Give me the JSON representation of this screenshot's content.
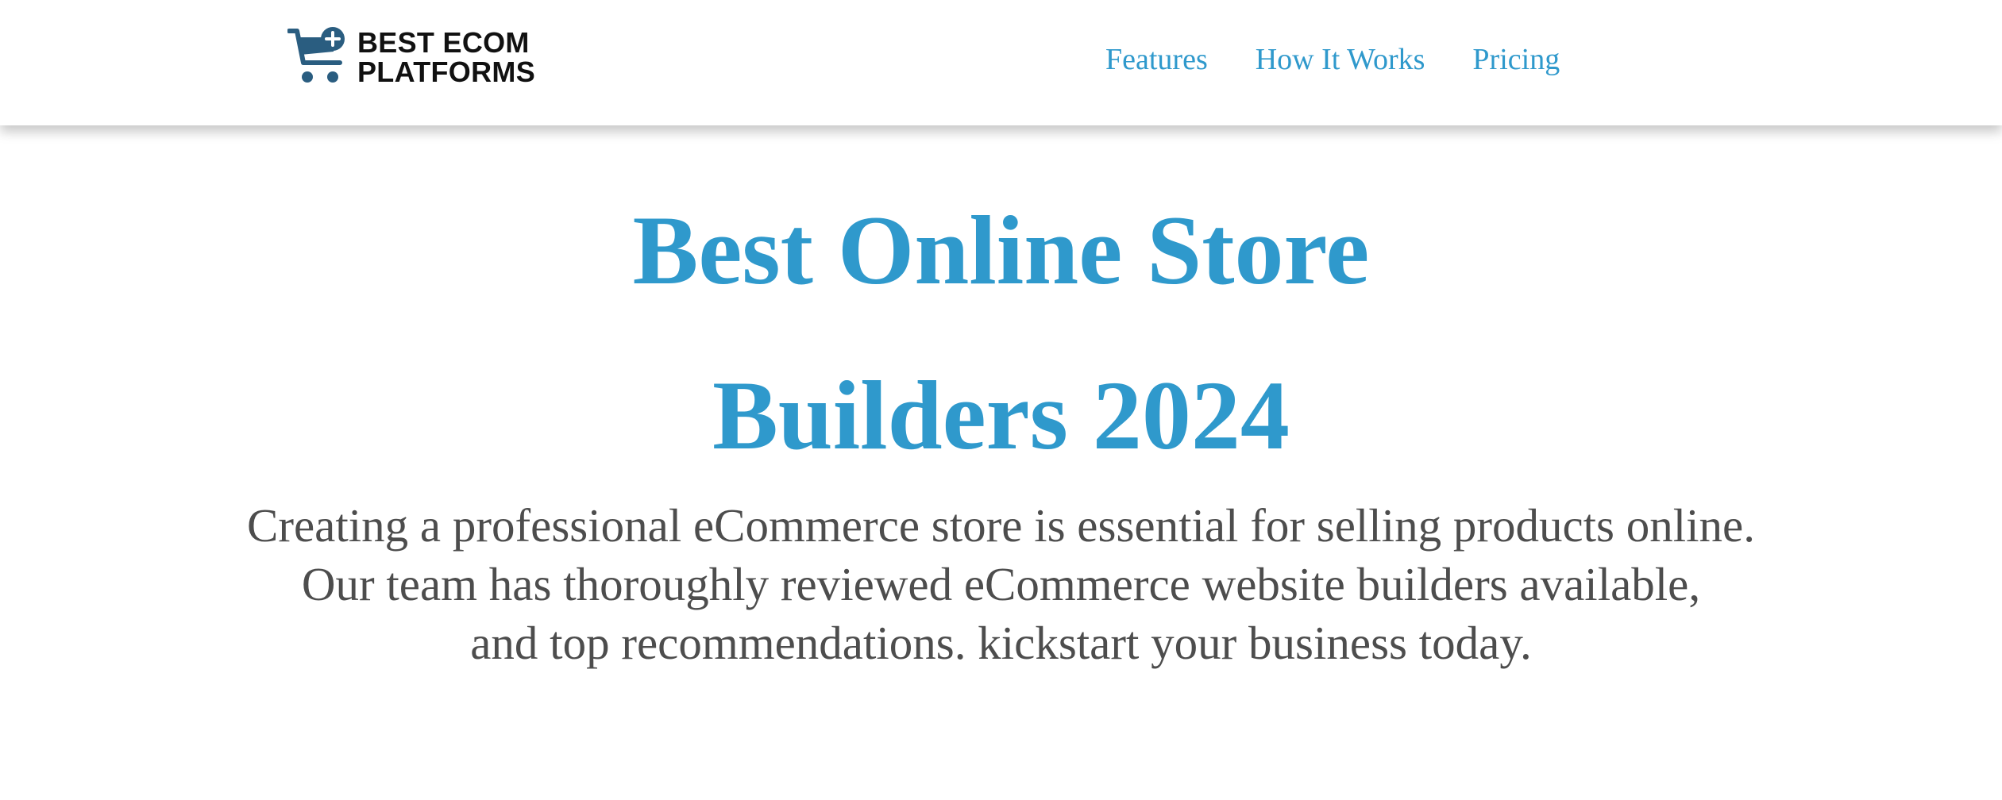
{
  "header": {
    "logo": {
      "line1": "BEST ECOM",
      "line2": "PLATFORMS",
      "icon": "shopping-cart-plus-icon"
    },
    "nav": [
      {
        "label": "Features"
      },
      {
        "label": "How It Works"
      },
      {
        "label": "Pricing"
      }
    ]
  },
  "hero": {
    "title_line1": "Best Online Store",
    "title_line2": "Builders 2024",
    "subtitle_lines": [
      "Creating a professional eCommerce store is essential for selling products online.",
      "Our team has thoroughly reviewed eCommerce website builders available,",
      "and top recommendations. kickstart your business today."
    ]
  },
  "colors": {
    "accent": "#2f99cc",
    "logo_icon": "#2a5d80",
    "body_text": "#4d4d4d",
    "logo_text": "#111111"
  }
}
